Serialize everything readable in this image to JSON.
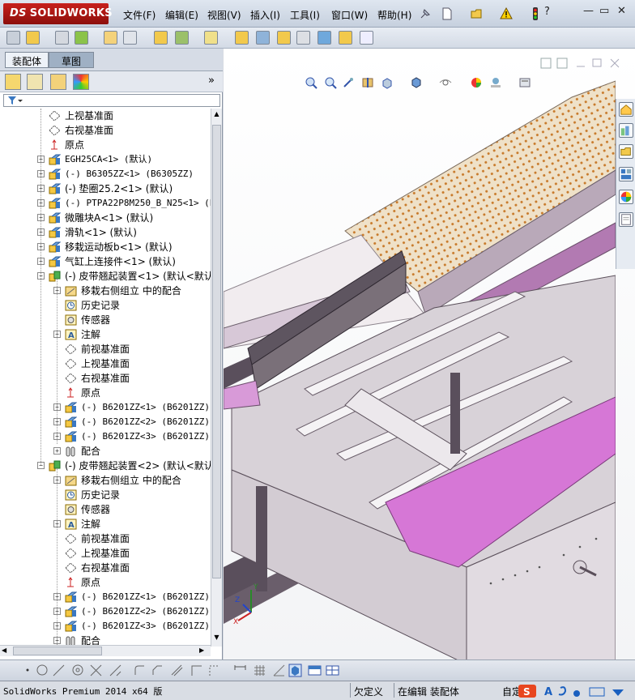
{
  "app": {
    "brand": "SOLIDWORKS",
    "brand_prefix": "DS",
    "accent": "#c8201c"
  },
  "menu": [
    "文件(F)",
    "编辑(E)",
    "视图(V)",
    "插入(I)",
    "工具(I)",
    "窗口(W)",
    "帮助(H)"
  ],
  "window_controls": {
    "minimize": "—",
    "restore": "▭",
    "close": "✕"
  },
  "tabs": {
    "assembly": "装配体",
    "sketch": "草图"
  },
  "tree": {
    "rows": [
      {
        "indent": 0,
        "exp": "",
        "icon": "plane-icon",
        "label": "上视基准面"
      },
      {
        "indent": 0,
        "exp": "",
        "icon": "plane-icon",
        "label": "右视基准面"
      },
      {
        "indent": 0,
        "exp": "",
        "icon": "origin-icon",
        "label": "原点"
      },
      {
        "indent": 0,
        "exp": "+",
        "icon": "part-icon",
        "label": "EGH25CA<1> (默认)",
        "mono": true
      },
      {
        "indent": 0,
        "exp": "+",
        "icon": "part-icon",
        "label": "(-) B6305ZZ<1> (B6305ZZ)",
        "mono": true
      },
      {
        "indent": 0,
        "exp": "+",
        "icon": "part-icon",
        "label": "(-) 垫圈25.2<1> (默认)"
      },
      {
        "indent": 0,
        "exp": "+",
        "icon": "part-icon",
        "label": "(-) PTPA22P8M250_B_N25<1> (PTP",
        "mono": true
      },
      {
        "indent": 0,
        "exp": "+",
        "icon": "part-icon",
        "label": "微雕块A<1> (默认)"
      },
      {
        "indent": 0,
        "exp": "+",
        "icon": "part-icon",
        "label": "滑轨<1> (默认)"
      },
      {
        "indent": 0,
        "exp": "+",
        "icon": "part-icon",
        "label": "移栽运动板b<1> (默认)"
      },
      {
        "indent": 0,
        "exp": "+",
        "icon": "part-icon",
        "label": "气缸上连接件<1> (默认)"
      },
      {
        "indent": 0,
        "exp": "−",
        "icon": "assembly-icon",
        "label": "(-) 皮带翘起装置<1> (默认<默认"
      },
      {
        "indent": 1,
        "exp": "+",
        "icon": "mate-folder-icon",
        "label": "移栽右侧组立 中的配合"
      },
      {
        "indent": 1,
        "exp": "",
        "icon": "history-icon",
        "label": "历史记录"
      },
      {
        "indent": 1,
        "exp": "",
        "icon": "sensor-icon",
        "label": "传感器"
      },
      {
        "indent": 1,
        "exp": "+",
        "icon": "annotation-icon",
        "label": "注解"
      },
      {
        "indent": 1,
        "exp": "",
        "icon": "plane-icon",
        "label": "前视基准面"
      },
      {
        "indent": 1,
        "exp": "",
        "icon": "plane-icon",
        "label": "上视基准面"
      },
      {
        "indent": 1,
        "exp": "",
        "icon": "plane-icon",
        "label": "右视基准面"
      },
      {
        "indent": 1,
        "exp": "",
        "icon": "origin-icon",
        "label": "原点"
      },
      {
        "indent": 1,
        "exp": "+",
        "icon": "part-icon",
        "label": "(-) B6201ZZ<1> (B6201ZZ)",
        "mono": true
      },
      {
        "indent": 1,
        "exp": "+",
        "icon": "part-icon",
        "label": "(-) B6201ZZ<2> (B6201ZZ)",
        "mono": true
      },
      {
        "indent": 1,
        "exp": "+",
        "icon": "part-icon",
        "label": "(-) B6201ZZ<3> (B6201ZZ)",
        "mono": true
      },
      {
        "indent": 1,
        "exp": "+",
        "icon": "mates-icon",
        "label": "配合"
      },
      {
        "indent": 0,
        "exp": "−",
        "icon": "assembly-icon",
        "label": "(-) 皮带翘起装置<2> (默认<默认"
      },
      {
        "indent": 1,
        "exp": "+",
        "icon": "mate-folder-icon",
        "label": "移栽右侧组立 中的配合"
      },
      {
        "indent": 1,
        "exp": "",
        "icon": "history-icon",
        "label": "历史记录"
      },
      {
        "indent": 1,
        "exp": "",
        "icon": "sensor-icon",
        "label": "传感器"
      },
      {
        "indent": 1,
        "exp": "+",
        "icon": "annotation-icon",
        "label": "注解"
      },
      {
        "indent": 1,
        "exp": "",
        "icon": "plane-icon",
        "label": "前视基准面"
      },
      {
        "indent": 1,
        "exp": "",
        "icon": "plane-icon",
        "label": "上视基准面"
      },
      {
        "indent": 1,
        "exp": "",
        "icon": "plane-icon",
        "label": "右视基准面"
      },
      {
        "indent": 1,
        "exp": "",
        "icon": "origin-icon",
        "label": "原点"
      },
      {
        "indent": 1,
        "exp": "+",
        "icon": "part-icon",
        "label": "(-) B6201ZZ<1> (B6201ZZ)",
        "mono": true
      },
      {
        "indent": 1,
        "exp": "+",
        "icon": "part-icon",
        "label": "(-) B6201ZZ<2> (B6201ZZ)",
        "mono": true
      },
      {
        "indent": 1,
        "exp": "+",
        "icon": "part-icon",
        "label": "(-) B6201ZZ<3> (B6201ZZ)",
        "mono": true
      },
      {
        "indent": 1,
        "exp": "+",
        "icon": "mates-icon",
        "label": "配合"
      }
    ]
  },
  "triad": {
    "x": "X",
    "y": "Y",
    "z": "Z"
  },
  "status": {
    "version": "SolidWorks Premium 2014 x64 版",
    "under_defined": "欠定义",
    "editing": "在编辑 装配体",
    "custom": "自定"
  },
  "colors": {
    "model_violet": "#d677d6",
    "frame_grey": "#c9c3c9",
    "dark_rail": "#5a4f5c",
    "mesh_tan": "#efe0c6"
  }
}
